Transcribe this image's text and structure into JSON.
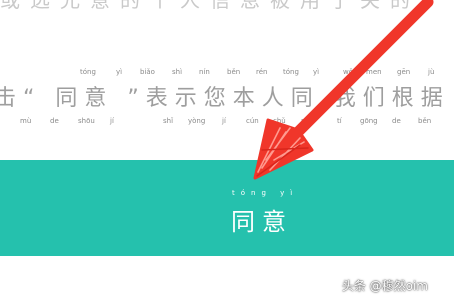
{
  "cut_text": "或选允意的个人信息被用于关的",
  "pinyin_top": [
    "tóng",
    "yì",
    "biǎo",
    "shì",
    "nín",
    "běn",
    "rén",
    "tóng",
    "yì",
    "wǒ",
    "men",
    "gēn",
    "jù"
  ],
  "main_text": "击“ 同意 ”表示您本人同 我们根据",
  "pinyin_bottom": [
    "mù",
    "de",
    "shōu",
    "jí",
    "shǐ",
    "yòng",
    "jí",
    "cún",
    "chǔ",
    "nín",
    "tí",
    "gōng",
    "de",
    "běn"
  ],
  "agree_button": {
    "pinyin": "tóng yì",
    "label": "同意"
  },
  "watermark": "头条 @穆然oim",
  "colors": {
    "accent": "#25c1ad",
    "arrow": "#f0362a"
  }
}
